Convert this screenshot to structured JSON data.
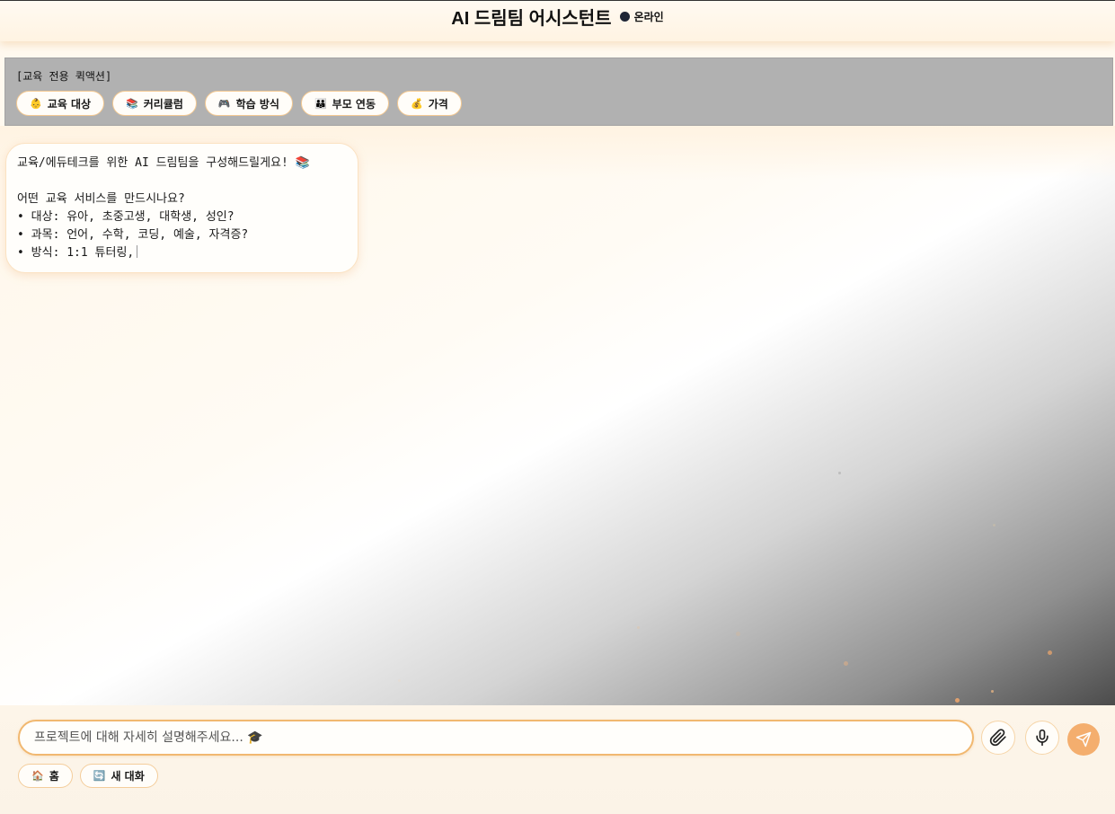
{
  "header": {
    "title": "AI 드림팀 어시스턴트",
    "status_label": "온라인"
  },
  "quick_actions": {
    "title": "[교육 전용 퀵액션]",
    "items": [
      {
        "icon": "👶",
        "label": "교육 대상"
      },
      {
        "icon": "📚",
        "label": "커리큘럼"
      },
      {
        "icon": "🎮",
        "label": "학습 방식"
      },
      {
        "icon": "👪",
        "label": "부모 연동"
      },
      {
        "icon": "💰",
        "label": "가격"
      }
    ]
  },
  "messages": [
    {
      "role": "assistant",
      "lines": [
        "교육/에듀테크를 위한 AI 드림팀을 구성해드릴게요! 📚",
        "",
        "어떤 교육 서비스를 만드시나요?",
        "• 대상: 유아, 초중고생, 대학생, 성인?",
        "• 과목: 언어, 수학, 코딩, 예술, 자격증?",
        "• 방식: 1:1 튜터링,"
      ]
    }
  ],
  "composer": {
    "placeholder": "프로젝트에 대해 자세히 설명해주세요... 🎓",
    "value": ""
  },
  "footer_nav": [
    {
      "icon": "🏠",
      "label": "홈"
    },
    {
      "icon": "🔄",
      "label": "새 대화"
    }
  ],
  "colors": {
    "accent": "#f4ae6e",
    "chip_border": "#f4c992",
    "panel_bg": "#b1b1b1",
    "status_dot": "#1e2535"
  }
}
